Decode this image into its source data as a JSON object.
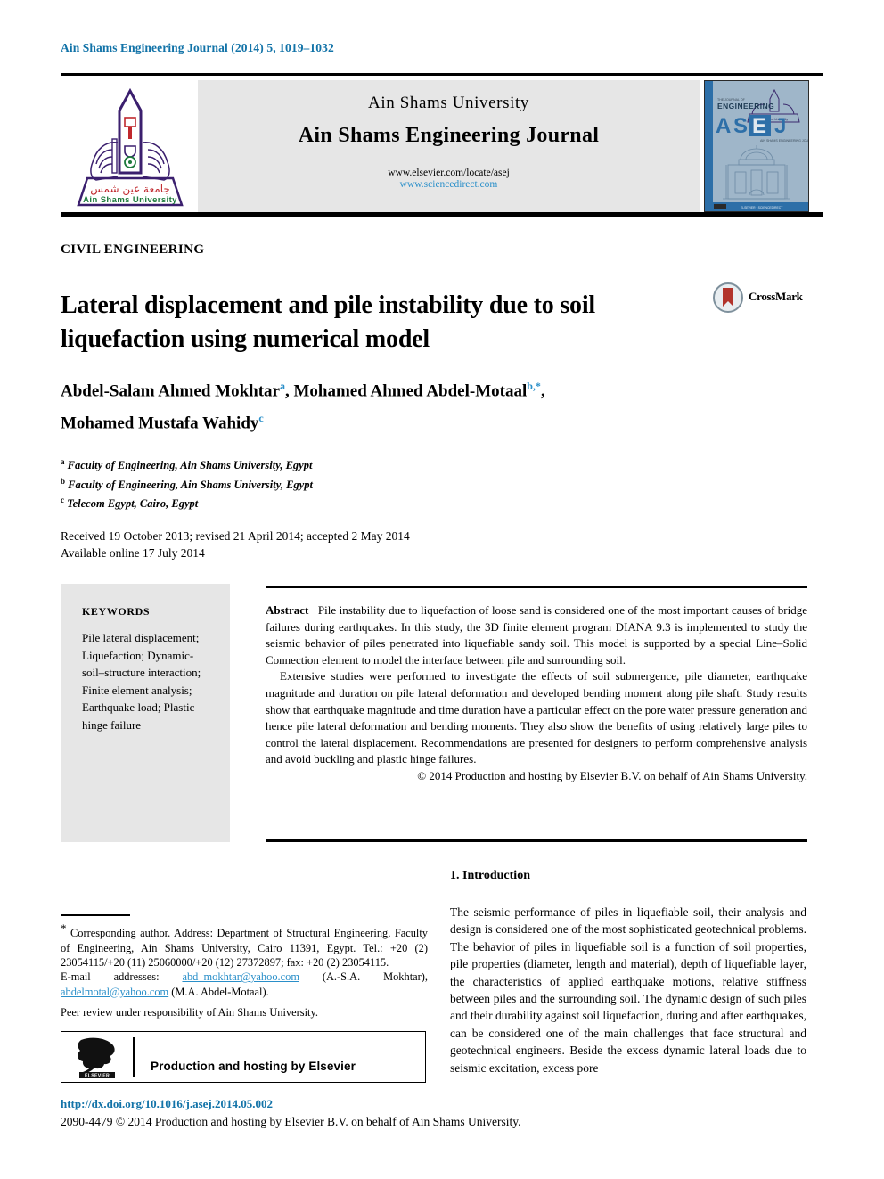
{
  "running_head": "Ain Shams Engineering Journal (2014) 5, 1019–1032",
  "masthead": {
    "university": "Ain Shams University",
    "journal": "Ain Shams Engineering Journal",
    "url_elsevier": "www.elsevier.com/locate/asej",
    "url_sciencedirect": "www.sciencedirect.com",
    "logo_alt": "Ain Shams University",
    "logo_arabic": "جامعة عين شمس",
    "logo_english": "Ain Shams University",
    "cover_word_engineering": "ENGINEERING",
    "cover_word_asej": "ASEJ",
    "cover_subtitle": "AIN SHAMS ENGINEERING JOURNAL"
  },
  "section_label": "CIVIL ENGINEERING",
  "title": "Lateral displacement and pile instability due to soil liquefaction using numerical model",
  "crossmark_label": "CrossMark",
  "authors_line1_name1": "Abdel-Salam Ahmed Mokhtar",
  "authors_line1_sup1": "a",
  "authors_line1_name2": "Mohamed Ahmed Abdel-Motaal",
  "authors_line1_sup2": "b,*",
  "authors_line2_name3": "Mohamed Mustafa Wahidy",
  "authors_line2_sup3": "c",
  "affiliations": [
    {
      "marker": "a",
      "text": "Faculty of Engineering, Ain Shams University, Egypt"
    },
    {
      "marker": "b",
      "text": "Faculty of Engineering, Ain Shams University, Egypt"
    },
    {
      "marker": "c",
      "text": "Telecom Egypt, Cairo, Egypt"
    }
  ],
  "history_line1": "Received 19 October 2013; revised 21 April 2014; accepted 2 May 2014",
  "history_line2": "Available online 17 July 2014",
  "keywords": {
    "heading": "KEYWORDS",
    "text": "Pile lateral displacement; Liquefaction; Dynamic-soil–structure interaction; Finite element analysis; Earthquake load; Plastic hinge failure"
  },
  "abstract": {
    "lead": "Abstract",
    "paragraph1": "Pile instability due to liquefaction of loose sand is considered one of the most important causes of bridge failures during earthquakes. In this study, the 3D finite element program DIANA 9.3 is implemented to study the seismic behavior of piles penetrated into liquefiable sandy soil. This model is supported by a special Line–Solid Connection element to model the interface between pile and surrounding soil.",
    "paragraph2": "Extensive studies were performed to investigate the effects of soil submergence, pile diameter, earthquake magnitude and duration on pile lateral deformation and developed bending moment along pile shaft. Study results show that earthquake magnitude and time duration have a particular effect on the pore water pressure generation and hence pile lateral deformation and bending moments. They also show the benefits of using relatively large piles to control the lateral displacement. Recommendations are presented for designers to perform comprehensive analysis and avoid buckling and plastic hinge failures.",
    "copyright": "© 2014 Production and hosting by Elsevier B.V. on behalf of Ain Shams University."
  },
  "introduction": {
    "heading": "1. Introduction",
    "body": "The seismic performance of piles in liquefiable soil, their analysis and design is considered one of the most sophisticated geotechnical problems. The behavior of piles in liquefiable soil is a function of soil properties, pile properties (diameter, length and material), depth of liquefiable layer, the characteristics of applied earthquake motions, relative stiffness between piles and the surrounding soil. The dynamic design of such piles and their durability against soil liquefaction, during and after earthquakes, can be considered one of the main challenges that face structural and geotechnical engineers. Beside the excess dynamic lateral loads due to seismic excitation, excess pore"
  },
  "footnote": {
    "star": "*",
    "corresponding": "Corresponding author. Address: Department of Structural Engineering, Faculty of Engineering, Ain Shams University, Cairo 11391, Egypt. Tel.: +20 (2) 23054115/+20 (11) 25060000/+20 (12) 27372897; fax: +20 (2) 23054115.",
    "email_label": "E-mail addresses:",
    "email1": "abd_mokhtar@yahoo.com",
    "email1_owner": "(A.-S.A. Mokhtar),",
    "email2": "abdelmotal@yahoo.com",
    "email2_owner": "(M.A. Abdel-Motaal).",
    "peer_review": "Peer review under responsibility of Ain Shams University."
  },
  "elsevier_box": {
    "logo_word": "ELSEVIER",
    "text": "Production and hosting by Elsevier"
  },
  "doi": "http://dx.doi.org/10.1016/j.asej.2014.05.002",
  "issn_line": "2090-4479 © 2014 Production and hosting by Elsevier B.V. on behalf of Ain Shams University.",
  "colors": {
    "link_blue": "#2a8fc9",
    "header_blue": "#1273a8",
    "band_gray": "#e6e6e6",
    "logo_purple": "#3b1f6e",
    "logo_red": "#c0282d",
    "logo_green": "#1d7a3c",
    "cover_blue": "#2d6fa8",
    "crossmark_red": "#b2342c"
  }
}
